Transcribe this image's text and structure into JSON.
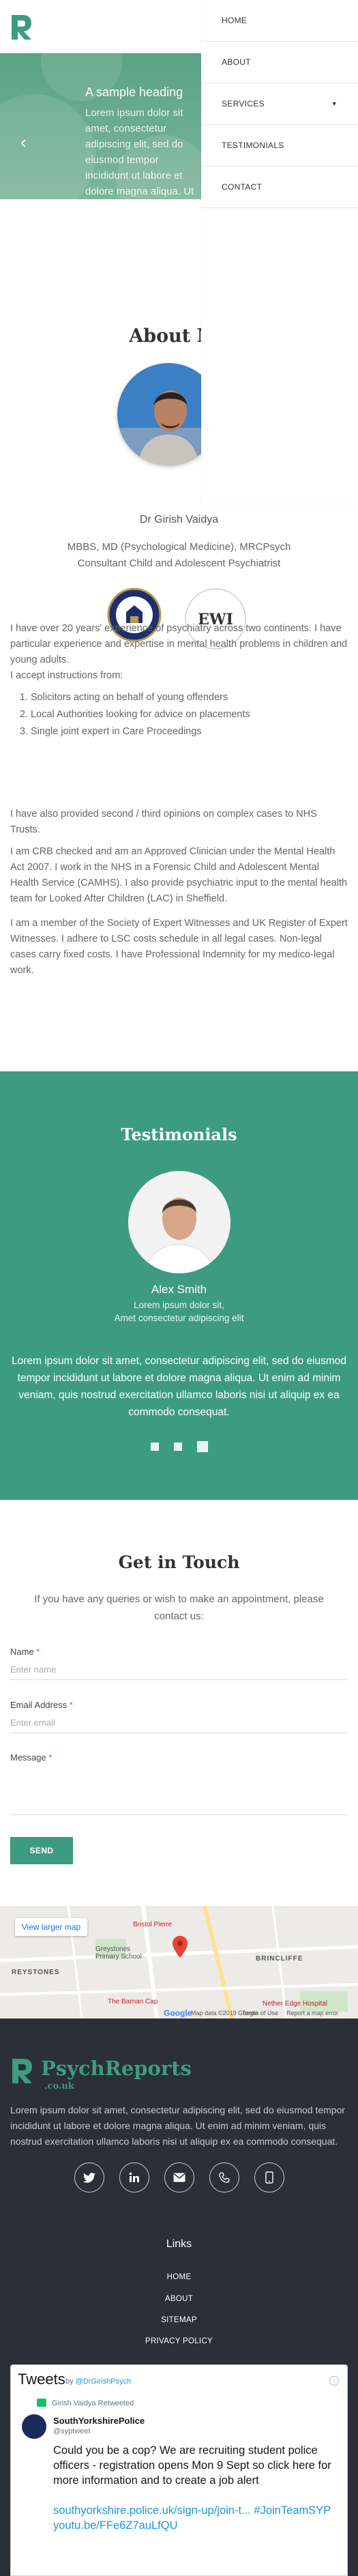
{
  "menu": {
    "items": [
      {
        "label": "HOME"
      },
      {
        "label": "ABOUT"
      },
      {
        "label": "SERVICES",
        "has_caret": true
      },
      {
        "label": "TESTIMONIALS"
      },
      {
        "label": "CONTACT"
      }
    ]
  },
  "hero": {
    "title": "A sample heading",
    "text": "Lorem ipsum dolor sit amet, consectetur adipiscing elit, sed do eiusmod tempor incididunt ut labore et dolore magna aliqua. Ut enim ad minim veniam, quis nostrud exercitation ullamco laboris nisi ut aliquip ex ea commodo consequat."
  },
  "about": {
    "heading": "About Me",
    "name": "Dr Girish Vaidya",
    "creds_line1": "MBBS, MD (Psychological Medicine), MRCPsych",
    "creds_line2": "Consultant Child and Adolescent Psychiatrist",
    "badge2_text": "EWI",
    "p1": "I have over 20 years' experience of psychiatry across two continents. I have particular experience and expertise in mental health problems in children and young adults.",
    "p2": "I accept instructions from:",
    "list": [
      "Solicitors acting on behalf of young offenders",
      "Local Authorities looking for advice on placements",
      "Single joint expert in Care Proceedings"
    ],
    "p3": "I have also provided second / third opinions on complex cases to NHS Trusts.",
    "p4": "I am CRB checked and am an Approved Clinician under the Mental Health Act 2007. I work in the NHS in a Forensic Child and Adolescent Mental Health Service (CAMHS). I also provide psychiatric input to the mental health team for Looked After Children (LAC) in Sheffield.",
    "p5": "I am a member of the Society of Expert Witnesses and UK Register of Expert Witnesses. I adhere to LSC costs schedule in all legal cases. Non-legal cases carry fixed costs. I have Professional Indemnity for my medico-legal work."
  },
  "testimonials": {
    "heading": "Testimonials",
    "name": "Alex Smith",
    "sub1": "Lorem ipsum dolor sit,",
    "sub2": "Amet consectetur adipiscing elit",
    "quote": "Lorem ipsum dolor sit amet, consectetur adipiscing elit, sed do eiusmod tempor incididunt ut labore et dolore magna aliqua. Ut enim ad minim veniam, quis nostrud exercitation ullamco laboris nisi ut aliquip ex ea commodo consequat.",
    "active_slide": 3,
    "slide_count": 3
  },
  "contact": {
    "heading": "Get in Touch",
    "intro_line1": "If you have any queries or wish to make an appointment, please",
    "intro_line2": "contact us:",
    "name_label": "Name",
    "name_placeholder": "Enter name",
    "email_label": "Email Address",
    "email_placeholder": "Enter email",
    "message_label": "Message",
    "required_mark": "*",
    "send_label": "SEND"
  },
  "map": {
    "button_label": "View larger map",
    "labels": {
      "greystones": "REYSTONES",
      "school": "Greystones Primary School",
      "bristol": "Bristol Pierre",
      "brincliffe": "BRINCLIFFE",
      "barnan": "The Barnan Cap",
      "nether": "Nether Edge Hospital",
      "terms": "Map data ©2019 Google",
      "terms2": "Terms of Use",
      "report": "Report a map error",
      "google": "Google"
    }
  },
  "footer": {
    "brand": "PsychReports",
    "brand_sub": ".co.uk",
    "text": "Lorem ipsum dolor sit amet, consectetur adipiscing elit, sed do eiusmod tempor incididunt ut labore et dolore magna aliqua. Ut enim ad minim veniam, quis nostrud exercitation ullamco laboris nisi ut aliquip ex ea commodo consequat.",
    "links_heading": "Links",
    "links": [
      "HOME",
      "ABOUT",
      "SITEMAP",
      "PRIVACY POLICY"
    ]
  },
  "tweets": {
    "title": "Tweets",
    "by": "by",
    "handle": "@DrGirishPsych",
    "retweeted": "Girish Vaidya Retweeted",
    "author": "SouthYorkshirePolice",
    "author_handle": "@syptweet",
    "body": "Could you be a cop? We are recruiting student police officers - registration opens Mon 9 Sept so click here for more information and to create a job alert",
    "link": "southyorkshire.police.uk/sign-up/join-t... #JoinTeamSYP youtu.be/FFe6Z7auLfQU",
    "info": "i"
  },
  "colors": {
    "accent": "#3d9c80",
    "hero": "#5aa386",
    "footer_bg": "#2b2f38",
    "required": "#d9534f"
  },
  "icons": {
    "logo": "r-logo-icon",
    "hero_prev": "chevron-left-icon",
    "services_caret": "caret-down-icon",
    "socials": [
      "twitter-icon",
      "linkedin-icon",
      "email-icon",
      "phone-icon",
      "mobile-icon"
    ],
    "map_pin": "map-pin-icon",
    "retweet": "retweet-icon",
    "info": "info-icon"
  }
}
